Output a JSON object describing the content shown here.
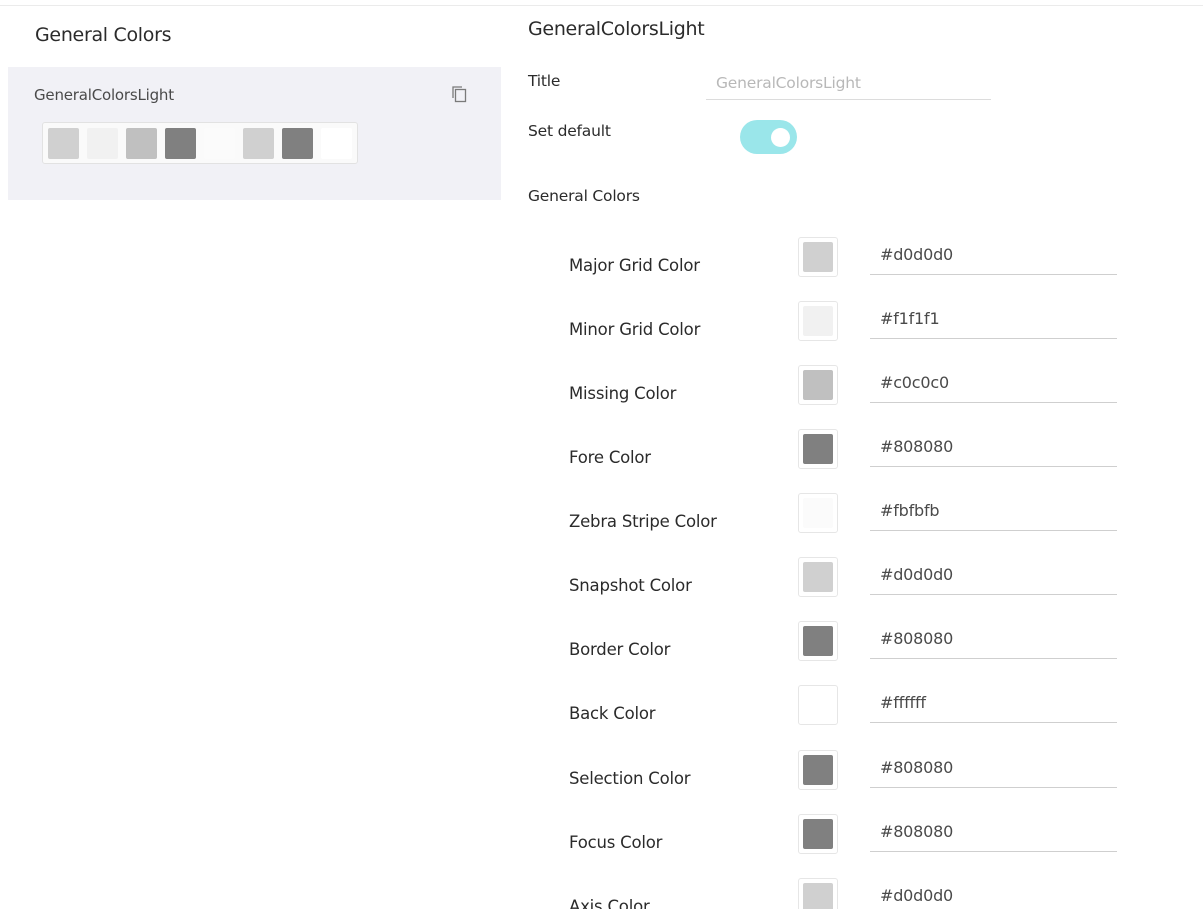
{
  "left": {
    "title": "General Colors",
    "theme": {
      "name": "GeneralColorsLight",
      "copy_icon": "copy-icon",
      "swatches": [
        "#d0d0d0",
        "#f1f1f1",
        "#c0c0c0",
        "#808080",
        "#fbfbfb",
        "#d0d0d0",
        "#808080",
        "#ffffff"
      ]
    }
  },
  "right": {
    "title": "GeneralColorsLight",
    "title_label": "Title",
    "title_value": "GeneralColorsLight",
    "set_default_label": "Set default",
    "set_default_on": true,
    "toggle_color": "#9ae6ea",
    "section_label": "General Colors",
    "rows": [
      {
        "label": "Major Grid Color",
        "value": "#d0d0d0"
      },
      {
        "label": "Minor Grid Color",
        "value": "#f1f1f1"
      },
      {
        "label": "Missing Color",
        "value": "#c0c0c0"
      },
      {
        "label": "Fore Color",
        "value": "#808080"
      },
      {
        "label": "Zebra Stripe Color",
        "value": "#fbfbfb"
      },
      {
        "label": "Snapshot Color",
        "value": "#d0d0d0"
      },
      {
        "label": "Border Color",
        "value": "#808080"
      },
      {
        "label": "Back Color",
        "value": "#ffffff"
      },
      {
        "label": "Selection Color",
        "value": "#808080"
      },
      {
        "label": "Focus Color",
        "value": "#808080"
      },
      {
        "label": "Axis Color",
        "value": "#d0d0d0"
      }
    ]
  }
}
